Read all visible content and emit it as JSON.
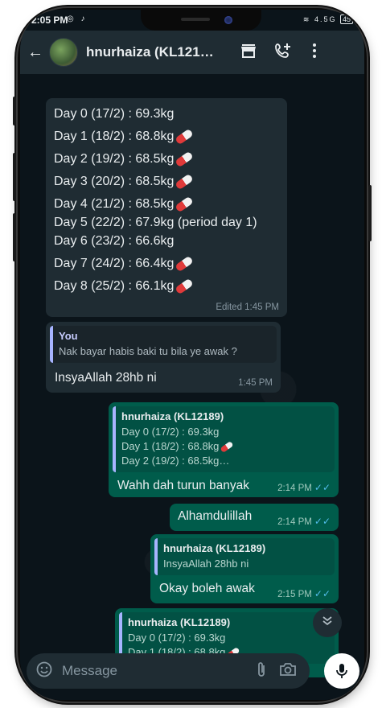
{
  "status_bar": {
    "time": "2:05 PM",
    "network": "4.5G",
    "battery": "45"
  },
  "header": {
    "back_glyph": "←",
    "contact_name": "hnurhaiza (KL121…"
  },
  "message1": {
    "lines": [
      "Day 0 (17/2) : 69.3kg",
      "Day 1 (18/2) : 68.8kg",
      "Day 2 (19/2) : 68.5kg",
      "Day 3 (20/2) : 68.5kg",
      "Day 4 (21/2) : 68.5kg",
      "Day 5 (22/2) : 67.9kg (period day 1)",
      "Day 6 (23/2) : 66.6kg",
      "Day 7 (24/2) : 66.4kg",
      "Day 8 (25/2) : 66.1kg"
    ],
    "meta": "Edited  1:45 PM"
  },
  "message2": {
    "quote_name": "You",
    "quote_text": "Nak bayar habis baki tu bila ye awak ?",
    "text": "InsyaAllah 28hb ni",
    "time": "1:45 PM"
  },
  "message3": {
    "quote_name": "hnurhaiza (KL12189)",
    "quote_lines": [
      "Day 0 (17/2) : 69.3kg",
      "Day 1 (18/2) : 68.8kg",
      "Day 2 (19/2) : 68.5kg…"
    ],
    "text": "Wahh dah turun banyak",
    "time": "2:14 PM"
  },
  "message4": {
    "text": "Alhamdulillah",
    "time": "2:14 PM"
  },
  "message5": {
    "quote_name": "hnurhaiza (KL12189)",
    "quote_text": "InsyaAllah 28hb ni",
    "text": "Okay boleh awak",
    "time": "2:15 PM"
  },
  "message6": {
    "quote_name": "hnurhaiza (KL12189)",
    "quote_lines": [
      "Day 0 (17/2) : 69.3kg",
      "Day 1 (18/2) : 68.8kg"
    ]
  },
  "composer": {
    "placeholder": "Message"
  },
  "icons": {
    "back": "arrow-left-icon",
    "shop": "shop-icon",
    "add_call": "add-call-icon",
    "more": "more-vert-icon",
    "emoji": "sticker-icon",
    "attach": "paperclip-icon",
    "camera": "camera-icon",
    "mic": "mic-icon",
    "scroll": "chevron-double-down-icon",
    "pill": "pill-emoji"
  },
  "colors": {
    "bg": "#0b141a",
    "incoming": "#1f2c33",
    "outgoing": "#005c4b",
    "ticks": "#53bdeb"
  }
}
